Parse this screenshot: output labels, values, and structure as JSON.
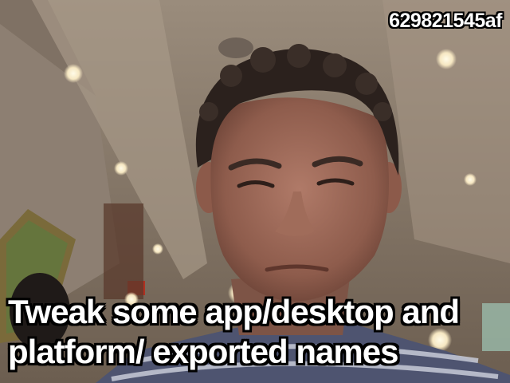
{
  "image_id_label": "629821545af",
  "caption": {
    "line1": "Tweak some app/desktop and",
    "line2": "platform/ exported names"
  }
}
